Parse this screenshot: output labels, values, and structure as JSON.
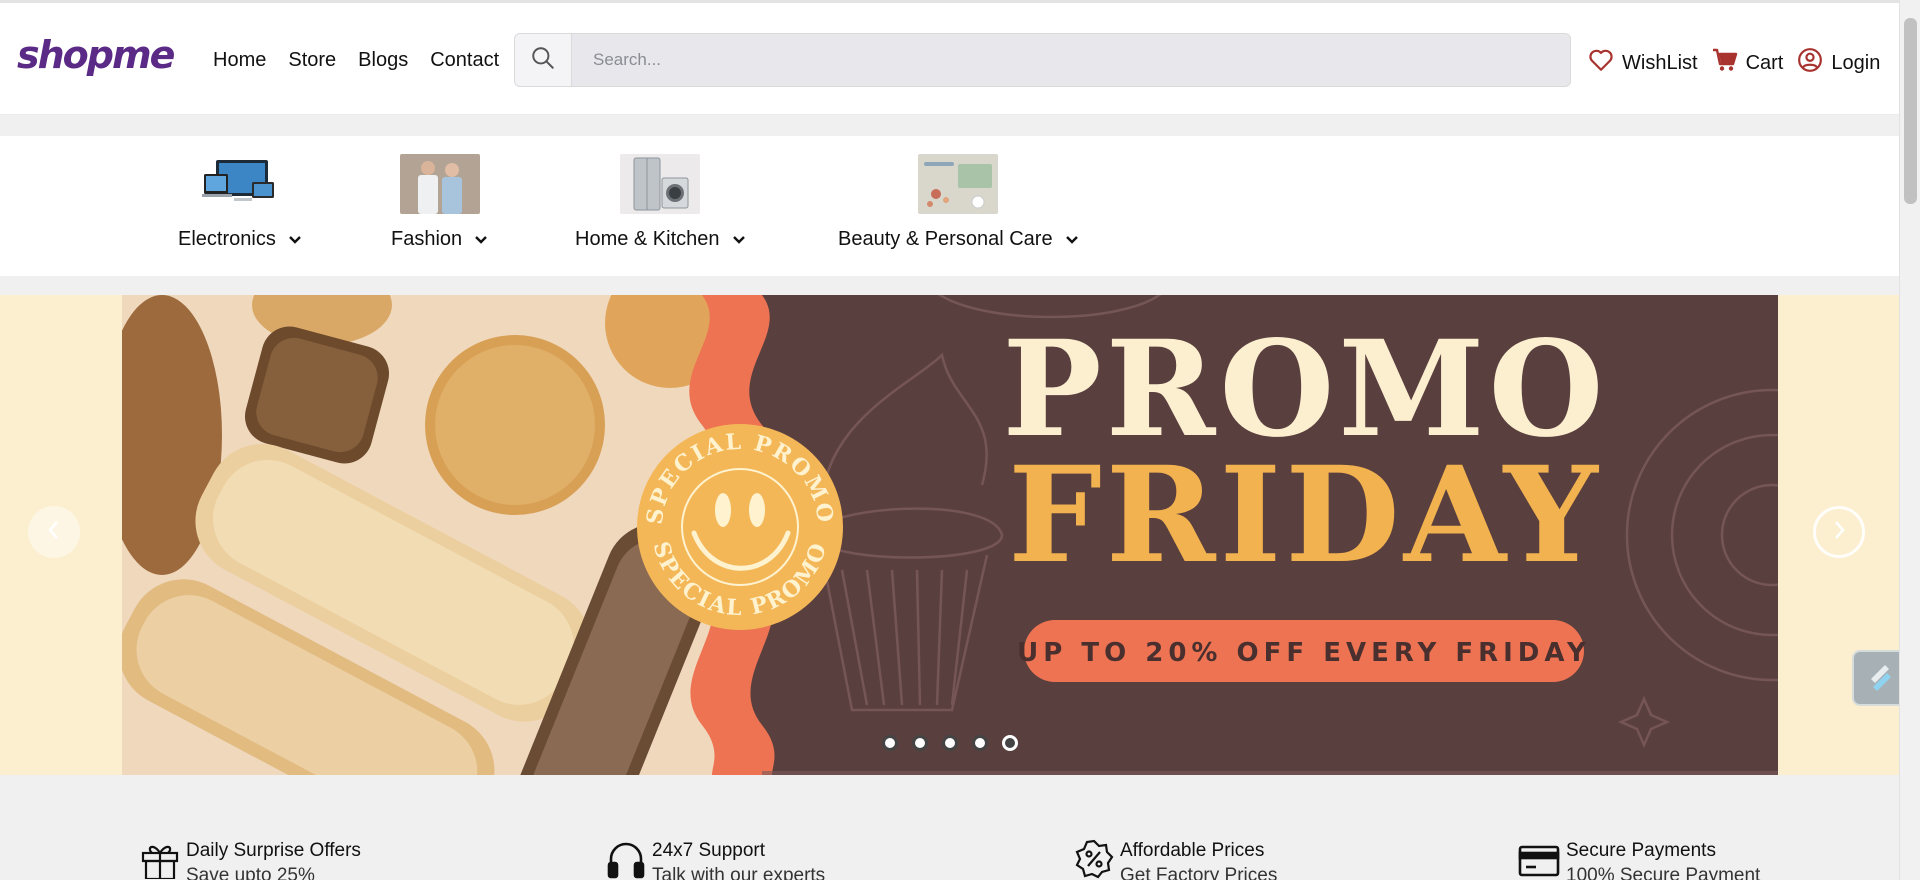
{
  "brand": {
    "logo_text": "shopme",
    "accent": "#5b2a86"
  },
  "nav": {
    "items": [
      "Home",
      "Store",
      "Blogs",
      "Contact"
    ]
  },
  "search": {
    "placeholder": "Search..."
  },
  "actions": {
    "wishlist": "WishList",
    "cart": "Cart",
    "login": "Login"
  },
  "categories": [
    {
      "label": "Electronics",
      "icon": "chevron-down-icon"
    },
    {
      "label": "Fashion",
      "icon": "chevron-down-icon"
    },
    {
      "label": "Home & Kitchen",
      "icon": "chevron-down-icon"
    },
    {
      "label": "Beauty & Personal Care",
      "icon": "chevron-down-icon"
    }
  ],
  "banner": {
    "badge_text": "SPECIAL PROMO",
    "headline_1": "PROMO",
    "headline_2": "FRIDAY",
    "cta": "UP TO 20% OFF EVERY FRIDAY",
    "slide_count": 5,
    "colors": {
      "bg": "#5a3f3f",
      "cream": "#fcefd0",
      "gold": "#f2b24f",
      "orange": "#ee7352"
    }
  },
  "services": [
    {
      "title": "Daily Surprise Offers",
      "subtitle": "Save upto 25%",
      "icon": "gift-icon"
    },
    {
      "title": "24x7 Support",
      "subtitle": "Talk with our experts",
      "icon": "headphones-icon"
    },
    {
      "title": "Affordable Prices",
      "subtitle": "Get Factory Prices",
      "icon": "discount-badge-icon"
    },
    {
      "title": "Secure Payments",
      "subtitle": "100% Secure Payment",
      "icon": "credit-card-icon"
    }
  ]
}
